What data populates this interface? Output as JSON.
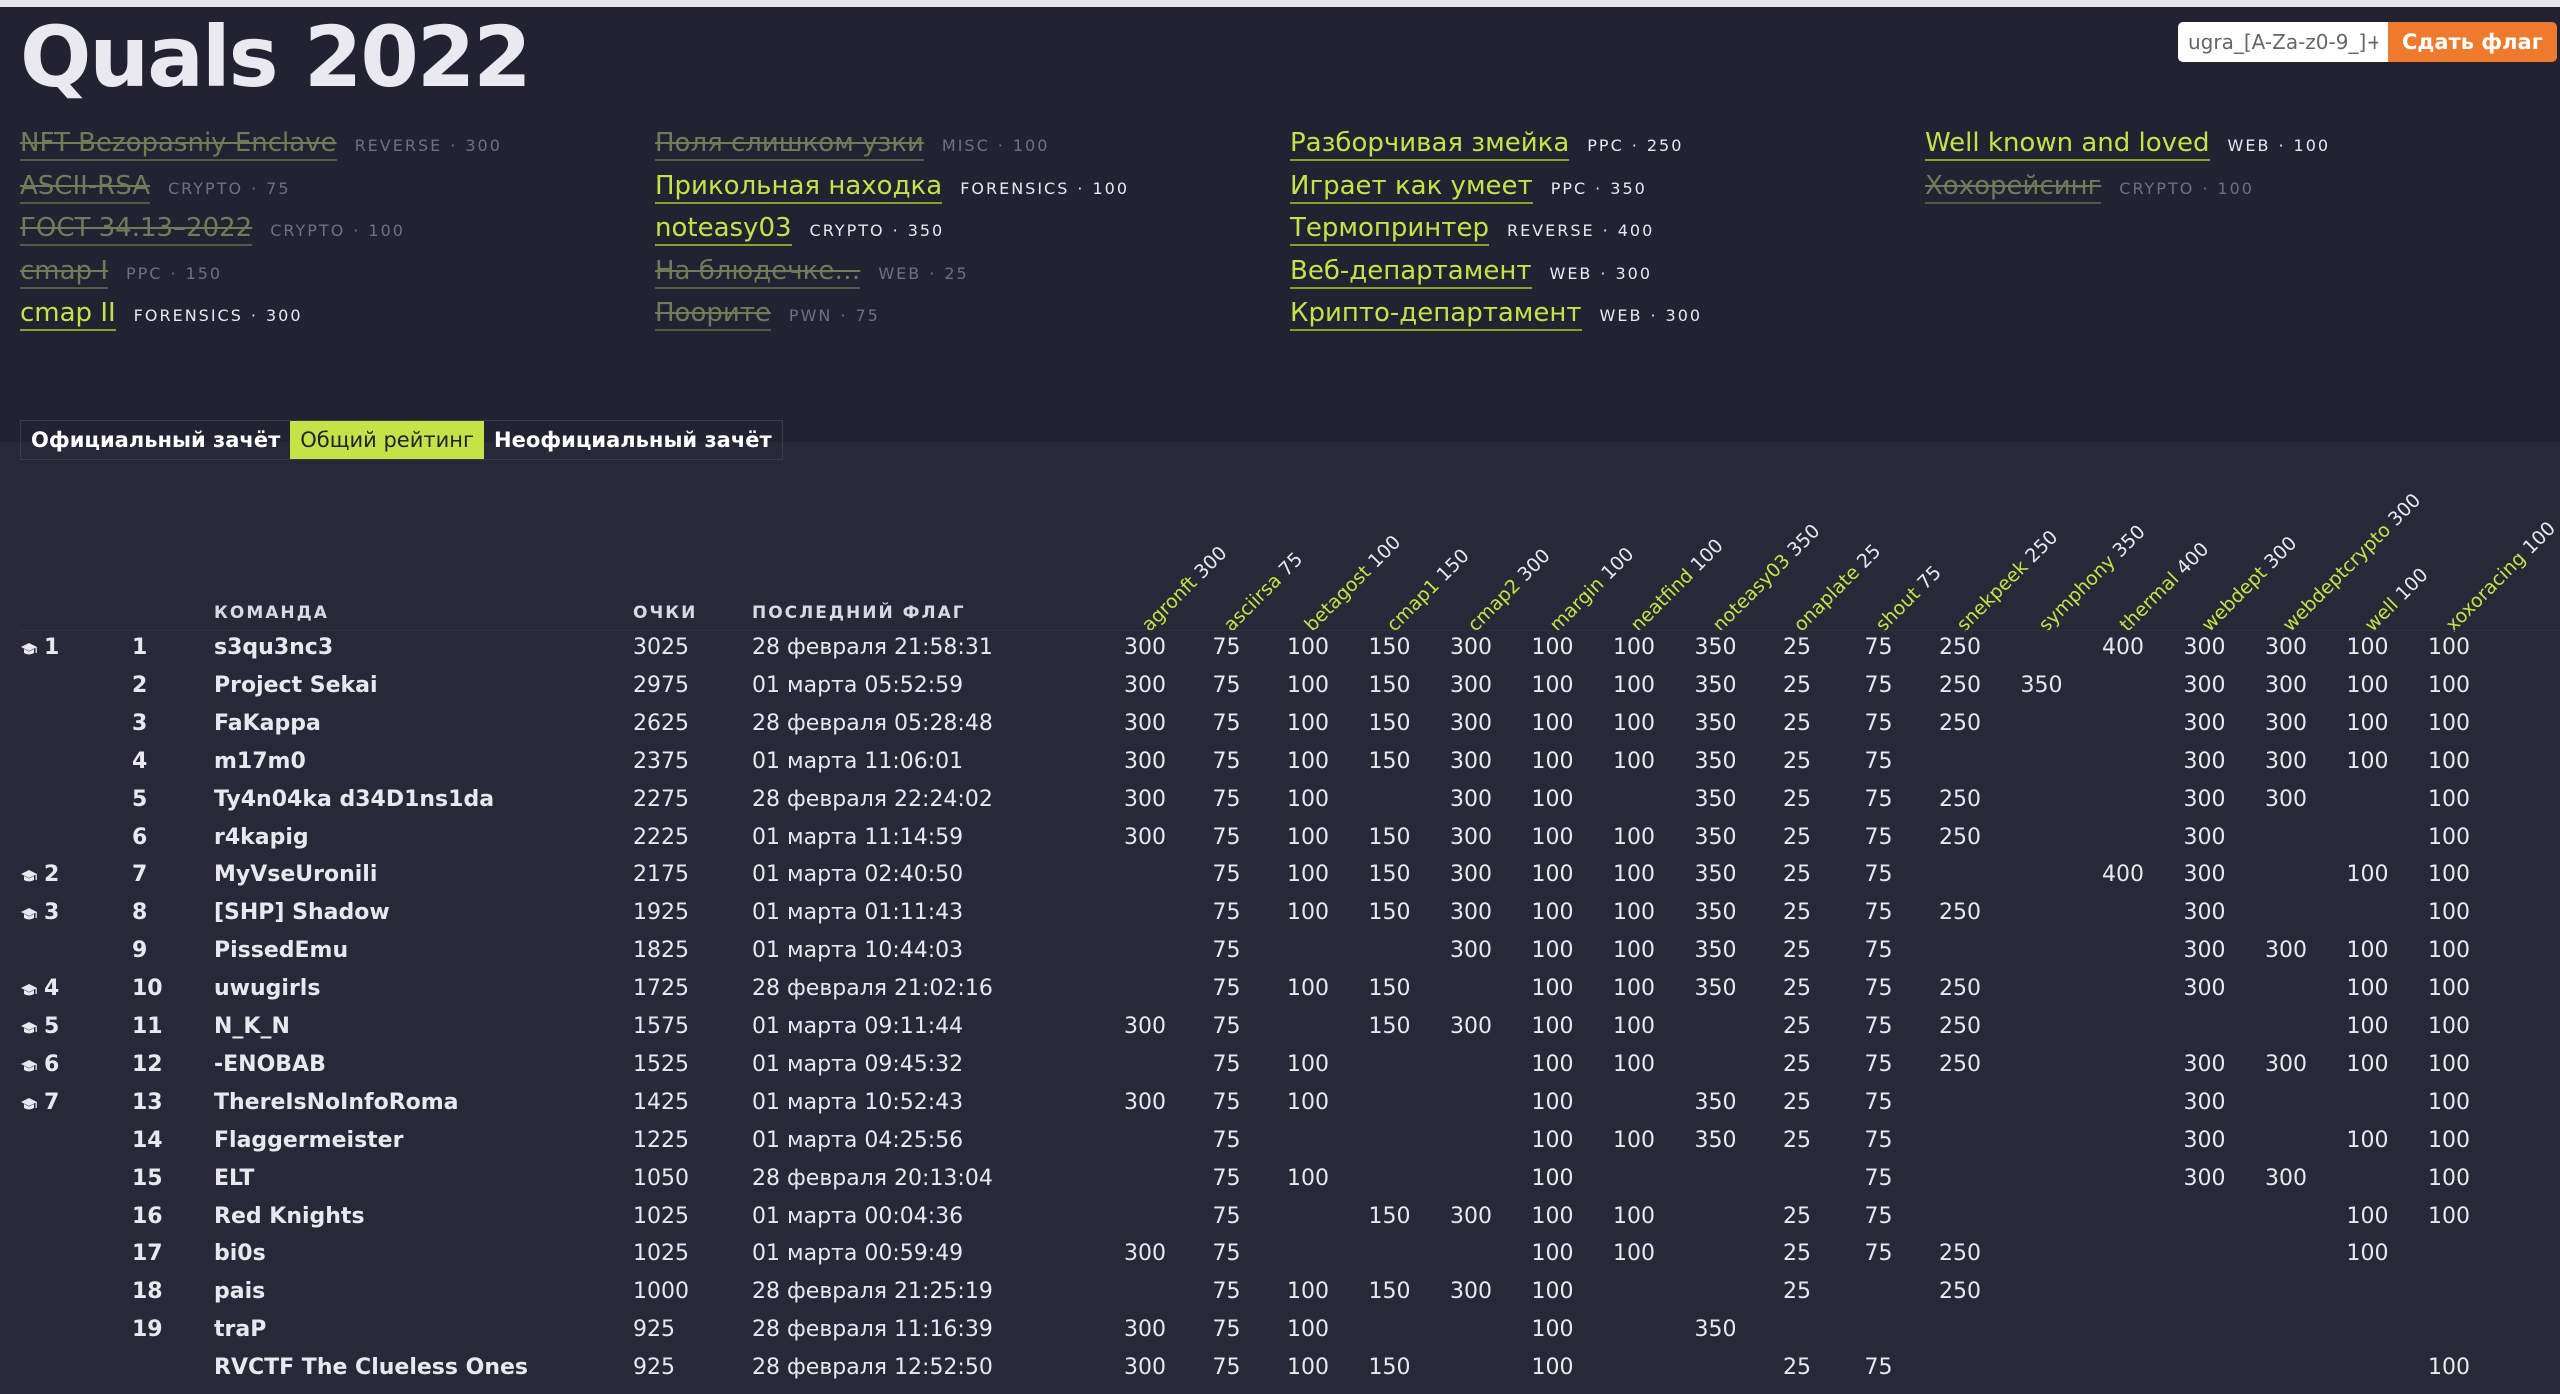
{
  "page": {
    "title": "Quals 2022"
  },
  "flag_form": {
    "placeholder": "ugra_[A-Za-z0-9_]+",
    "submit_label": "Сдать флаг"
  },
  "tasks": [
    [
      {
        "name": "NFT Bezopasniy Enclave",
        "category": "REVERSE",
        "points": "300",
        "solved": true
      },
      {
        "name": "ASCII-RSA",
        "category": "CRYPTO",
        "points": "75",
        "solved": true
      },
      {
        "name": "ГОСТ 34.13–2022",
        "category": "CRYPTO",
        "points": "100",
        "solved": true
      },
      {
        "name": "cmap I",
        "category": "PPC",
        "points": "150",
        "solved": true
      },
      {
        "name": "cmap II",
        "category": "FORENSICS",
        "points": "300",
        "solved": false
      }
    ],
    [
      {
        "name": "Поля слишком узки",
        "category": "MISC",
        "points": "100",
        "solved": true
      },
      {
        "name": "Прикольная находка",
        "category": "FORENSICS",
        "points": "100",
        "solved": false
      },
      {
        "name": "noteasy03",
        "category": "CRYPTO",
        "points": "350",
        "solved": false
      },
      {
        "name": "На блюдечке…",
        "category": "WEB",
        "points": "25",
        "solved": true
      },
      {
        "name": "Поорите",
        "category": "PWN",
        "points": "75",
        "solved": true
      }
    ],
    [
      {
        "name": "Разборчивая змейка",
        "category": "PPC",
        "points": "250",
        "solved": false
      },
      {
        "name": "Играет как умеет",
        "category": "PPC",
        "points": "350",
        "solved": false
      },
      {
        "name": "Термопринтер",
        "category": "REVERSE",
        "points": "400",
        "solved": false
      },
      {
        "name": "Веб-департамент",
        "category": "WEB",
        "points": "300",
        "solved": false
      },
      {
        "name": "Крипто-департамент",
        "category": "WEB",
        "points": "300",
        "solved": false
      }
    ],
    [
      {
        "name": "Well known and loved",
        "category": "WEB",
        "points": "100",
        "solved": false
      },
      {
        "name": "Хохорейсинг",
        "category": "CRYPTO",
        "points": "100",
        "solved": true
      }
    ]
  ],
  "tabs": [
    {
      "label": "Официальный зачёт",
      "active": false
    },
    {
      "label": "Общий рейтинг",
      "active": true
    },
    {
      "label": "Неофициальный зачёт",
      "active": false
    }
  ],
  "scoreboard": {
    "headers": {
      "team": "КОМАНДА",
      "score": "ОЧКИ",
      "last_flag": "ПОСЛЕДНИЙ ФЛАГ"
    },
    "task_columns": [
      {
        "name": "agronft",
        "points": "300"
      },
      {
        "name": "asciirsa",
        "points": "75"
      },
      {
        "name": "betagost",
        "points": "100"
      },
      {
        "name": "cmap1",
        "points": "150"
      },
      {
        "name": "cmap2",
        "points": "300"
      },
      {
        "name": "margin",
        "points": "100"
      },
      {
        "name": "neatfind",
        "points": "100"
      },
      {
        "name": "noteasy03",
        "points": "350"
      },
      {
        "name": "onaplate",
        "points": "25"
      },
      {
        "name": "shout",
        "points": "75"
      },
      {
        "name": "snekpeek",
        "points": "250"
      },
      {
        "name": "symphony",
        "points": "350"
      },
      {
        "name": "thermal",
        "points": "400"
      },
      {
        "name": "webdept",
        "points": "300"
      },
      {
        "name": "webdeptcrypto",
        "points": "300"
      },
      {
        "name": "well",
        "points": "100"
      },
      {
        "name": "xoxoracing",
        "points": "100"
      }
    ],
    "rows": [
      {
        "official": "1",
        "place": "1",
        "team": "s3qu3nc3",
        "score": "3025",
        "last_flag": "28 февраля 21:58:31",
        "solves": [
          "300",
          "75",
          "100",
          "150",
          "300",
          "100",
          "100",
          "350",
          "25",
          "75",
          "250",
          "",
          "400",
          "300",
          "300",
          "100",
          "100"
        ]
      },
      {
        "official": "",
        "place": "2",
        "team": "Project Sekai",
        "score": "2975",
        "last_flag": "01 марта 05:52:59",
        "solves": [
          "300",
          "75",
          "100",
          "150",
          "300",
          "100",
          "100",
          "350",
          "25",
          "75",
          "250",
          "350",
          "",
          "300",
          "300",
          "100",
          "100"
        ]
      },
      {
        "official": "",
        "place": "3",
        "team": "FaKappa",
        "score": "2625",
        "last_flag": "28 февраля 05:28:48",
        "solves": [
          "300",
          "75",
          "100",
          "150",
          "300",
          "100",
          "100",
          "350",
          "25",
          "75",
          "250",
          "",
          "",
          "300",
          "300",
          "100",
          "100"
        ]
      },
      {
        "official": "",
        "place": "4",
        "team": "m17m0",
        "score": "2375",
        "last_flag": "01 марта 11:06:01",
        "solves": [
          "300",
          "75",
          "100",
          "150",
          "300",
          "100",
          "100",
          "350",
          "25",
          "75",
          "",
          "",
          "",
          "300",
          "300",
          "100",
          "100"
        ]
      },
      {
        "official": "",
        "place": "5",
        "team": "Ty4n04ka d34D1ns1da",
        "score": "2275",
        "last_flag": "28 февраля 22:24:02",
        "solves": [
          "300",
          "75",
          "100",
          "",
          "300",
          "100",
          "",
          "350",
          "25",
          "75",
          "250",
          "",
          "",
          "300",
          "300",
          "",
          "100"
        ]
      },
      {
        "official": "",
        "place": "6",
        "team": "r4kapig",
        "score": "2225",
        "last_flag": "01 марта 11:14:59",
        "solves": [
          "300",
          "75",
          "100",
          "150",
          "300",
          "100",
          "100",
          "350",
          "25",
          "75",
          "250",
          "",
          "",
          "300",
          "",
          "",
          "100"
        ]
      },
      {
        "official": "2",
        "place": "7",
        "team": "MyVseUronili",
        "score": "2175",
        "last_flag": "01 марта 02:40:50",
        "solves": [
          "",
          "75",
          "100",
          "150",
          "300",
          "100",
          "100",
          "350",
          "25",
          "75",
          "",
          "",
          "400",
          "300",
          "",
          "100",
          "100"
        ]
      },
      {
        "official": "3",
        "place": "8",
        "team": "[SHP] Shadow",
        "score": "1925",
        "last_flag": "01 марта 01:11:43",
        "solves": [
          "",
          "75",
          "100",
          "150",
          "300",
          "100",
          "100",
          "350",
          "25",
          "75",
          "250",
          "",
          "",
          "300",
          "",
          "",
          "100"
        ]
      },
      {
        "official": "",
        "place": "9",
        "team": "PissedEmu",
        "score": "1825",
        "last_flag": "01 марта 10:44:03",
        "solves": [
          "",
          "75",
          "",
          "",
          "300",
          "100",
          "100",
          "350",
          "25",
          "75",
          "",
          "",
          "",
          "300",
          "300",
          "100",
          "100"
        ]
      },
      {
        "official": "4",
        "place": "10",
        "team": "uwugirls",
        "score": "1725",
        "last_flag": "28 февраля 21:02:16",
        "solves": [
          "",
          "75",
          "100",
          "150",
          "",
          "100",
          "100",
          "350",
          "25",
          "75",
          "250",
          "",
          "",
          "300",
          "",
          "100",
          "100"
        ]
      },
      {
        "official": "5",
        "place": "11",
        "team": "N_K_N",
        "score": "1575",
        "last_flag": "01 марта 09:11:44",
        "solves": [
          "300",
          "75",
          "",
          "150",
          "300",
          "100",
          "100",
          "",
          "25",
          "75",
          "250",
          "",
          "",
          "",
          "",
          "100",
          "100"
        ]
      },
      {
        "official": "6",
        "place": "12",
        "team": "-ENOBAB",
        "score": "1525",
        "last_flag": "01 марта 09:45:32",
        "solves": [
          "",
          "75",
          "100",
          "",
          "",
          "100",
          "100",
          "",
          "25",
          "75",
          "250",
          "",
          "",
          "300",
          "300",
          "100",
          "100"
        ]
      },
      {
        "official": "7",
        "place": "13",
        "team": "ThereIsNoInfoRoma",
        "score": "1425",
        "last_flag": "01 марта 10:52:43",
        "solves": [
          "300",
          "75",
          "100",
          "",
          "",
          "100",
          "",
          "350",
          "25",
          "75",
          "",
          "",
          "",
          "300",
          "",
          "",
          "100"
        ]
      },
      {
        "official": "",
        "place": "14",
        "team": "Flaggermeister",
        "score": "1225",
        "last_flag": "01 марта 04:25:56",
        "solves": [
          "",
          "75",
          "",
          "",
          "",
          "100",
          "100",
          "350",
          "25",
          "75",
          "",
          "",
          "",
          "300",
          "",
          "100",
          "100"
        ]
      },
      {
        "official": "",
        "place": "15",
        "team": "ELT",
        "score": "1050",
        "last_flag": "28 февраля 20:13:04",
        "solves": [
          "",
          "75",
          "100",
          "",
          "",
          "100",
          "",
          "",
          "",
          "75",
          "",
          "",
          "",
          "300",
          "300",
          "",
          "100"
        ]
      },
      {
        "official": "",
        "place": "16",
        "team": "Red Knights",
        "score": "1025",
        "last_flag": "01 марта 00:04:36",
        "solves": [
          "",
          "75",
          "",
          "150",
          "300",
          "100",
          "100",
          "",
          "25",
          "75",
          "",
          "",
          "",
          "",
          "",
          "100",
          "100"
        ]
      },
      {
        "official": "",
        "place": "17",
        "team": "bi0s",
        "score": "1025",
        "last_flag": "01 марта 00:59:49",
        "solves": [
          "300",
          "75",
          "",
          "",
          "",
          "100",
          "100",
          "",
          "25",
          "75",
          "250",
          "",
          "",
          "",
          "",
          "100",
          ""
        ]
      },
      {
        "official": "",
        "place": "18",
        "team": "pais",
        "score": "1000",
        "last_flag": "28 февраля 21:25:19",
        "solves": [
          "",
          "75",
          "100",
          "150",
          "300",
          "100",
          "",
          "",
          "25",
          "",
          "250",
          "",
          "",
          "",
          "",
          "",
          ""
        ]
      },
      {
        "official": "",
        "place": "19",
        "team": "traP",
        "score": "925",
        "last_flag": "28 февраля 11:16:39",
        "solves": [
          "300",
          "75",
          "100",
          "",
          "",
          "100",
          "",
          "350",
          "",
          "",
          "",
          "",
          "",
          "",
          "",
          "",
          ""
        ]
      },
      {
        "official": "",
        "place": "",
        "team": "RVCTF The Clueless Ones",
        "score": "925",
        "last_flag": "28 февраля 12:52:50",
        "solves": [
          "300",
          "75",
          "100",
          "150",
          "",
          "100",
          "",
          "",
          "25",
          "75",
          "",
          "",
          "",
          "",
          "",
          "",
          "100"
        ]
      }
    ]
  },
  "colors": {
    "background": "#222233",
    "accent": "#c7e246",
    "submit": "#ee7a2e"
  },
  "icons": {
    "official_marker": "graduation-cap-icon"
  }
}
